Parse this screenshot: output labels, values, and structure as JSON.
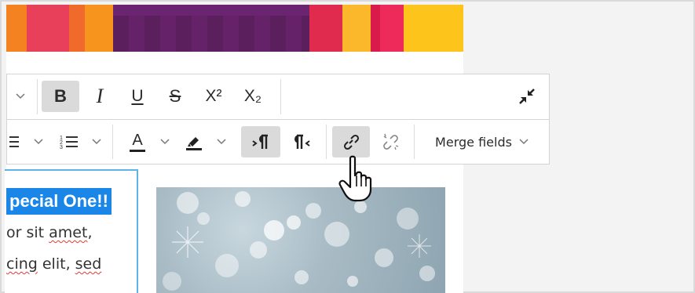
{
  "banner": {
    "colors": [
      "#f58220",
      "#e8405a",
      "#ef6a2b",
      "#f7941d",
      "#fbb034",
      "#5a1f5c",
      "#6b2470",
      "#e02b4f",
      "#fbb82a",
      "#d81b4a",
      "#ee2a5a",
      "#fdc41c"
    ]
  },
  "toolbar": {
    "row1": {
      "bold_label": "B",
      "italic_label": "I",
      "underline_label": "U",
      "strike_label": "S",
      "superscript_label": "X²",
      "subscript_label": "X₂",
      "chevron": "⌄"
    },
    "row2": {
      "merge_fields_label": "Merge fields",
      "chevron": "⌄",
      "font_color_letter": "A"
    },
    "colors": {
      "active_bg": "#dadada",
      "text": "#2b2b2b"
    }
  },
  "content": {
    "heading": "pecial One!!",
    "lines": [
      {
        "pre": "or sit ",
        "mark": "amet",
        "post": ","
      },
      {
        "pre": "",
        "mark": "cing",
        "post": " elit, ",
        "mark2": "sed"
      }
    ],
    "highlight_color": "#1a86e8",
    "border_color": "#5fb3e6"
  }
}
